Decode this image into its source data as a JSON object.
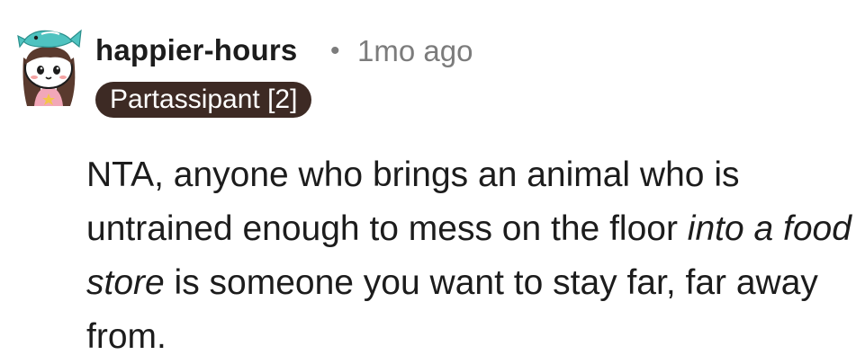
{
  "comment": {
    "author": "happier-hours",
    "separator": "•",
    "timestamp": "1mo ago",
    "flair": "Partassipant [2]",
    "avatar_icon": "snoo-avatar-icon",
    "body": {
      "part1": "NTA, anyone who brings an animal who is untrained enough to mess on the floor ",
      "italic": "into a food store",
      "part2": " is someone you want to stay far, far away from."
    }
  },
  "colors": {
    "flair_background": "#3d2a24",
    "meta_text": "#7c7c7c",
    "text": "#1c1c1c",
    "avatar_hat": "#4fc3c0",
    "avatar_hair": "#5a3a2e"
  }
}
